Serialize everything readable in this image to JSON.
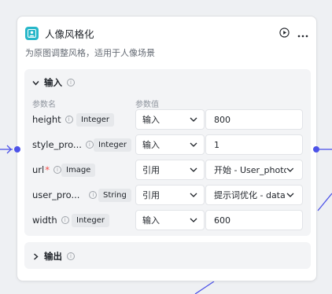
{
  "node": {
    "title": "人像风格化",
    "description": "为原图调整风格，适用于人像场景",
    "icon": "portrait-icon",
    "accent": "#27b7c9",
    "port_color": "#4d53e8"
  },
  "inputs": {
    "label": "输入",
    "col_name": "参数名",
    "col_value": "参数值",
    "params": [
      {
        "name": "height",
        "required": false,
        "type": "Integer",
        "mode": "输入",
        "value": "800"
      },
      {
        "name": "style_pro...",
        "required": false,
        "type": "Integer",
        "mode": "输入",
        "value": "1"
      },
      {
        "name": "url",
        "required": true,
        "type": "Image",
        "mode": "引用",
        "value": "开始 - User_photo"
      },
      {
        "name": "user_pro...",
        "required": false,
        "type": "String",
        "mode": "引用",
        "value": "提示词优化 - data"
      },
      {
        "name": "width",
        "required": false,
        "type": "Integer",
        "mode": "输入",
        "value": "600"
      }
    ]
  },
  "outputs": {
    "label": "输出"
  }
}
